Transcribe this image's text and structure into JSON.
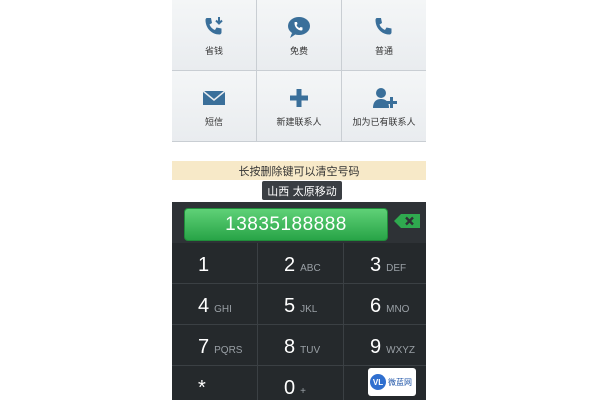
{
  "actions": [
    {
      "label": "省钱",
      "icon": "phone-save-icon"
    },
    {
      "label": "免费",
      "icon": "chat-phone-icon"
    },
    {
      "label": "普通",
      "icon": "phone-icon"
    },
    {
      "label": "短信",
      "icon": "envelope-icon"
    },
    {
      "label": "新建联系人",
      "icon": "plus-icon"
    },
    {
      "label": "加为已有联系人",
      "icon": "add-contact-icon"
    }
  ],
  "hint": "长按删除键可以清空号码",
  "location": "山西 太原移动",
  "dialed_number": "13835188888",
  "keypad": [
    {
      "digit": "1",
      "letters": ""
    },
    {
      "digit": "2",
      "letters": "ABC"
    },
    {
      "digit": "3",
      "letters": "DEF"
    },
    {
      "digit": "4",
      "letters": "GHI"
    },
    {
      "digit": "5",
      "letters": "JKL"
    },
    {
      "digit": "6",
      "letters": "MNO"
    },
    {
      "digit": "7",
      "letters": "PQRS"
    },
    {
      "digit": "8",
      "letters": "TUV"
    },
    {
      "digit": "9",
      "letters": "WXYZ"
    },
    {
      "digit": "*",
      "letters": ""
    },
    {
      "digit": "0",
      "letters": "+"
    },
    {
      "digit": "",
      "letters": ""
    }
  ],
  "watermark": {
    "logo": "VL",
    "text": "微蓝网"
  },
  "colors": {
    "accent_green": "#28a447",
    "hint_bg": "#f7e9c8",
    "dialer_bg": "#25292c",
    "icon_blue": "#3a6f9a"
  }
}
